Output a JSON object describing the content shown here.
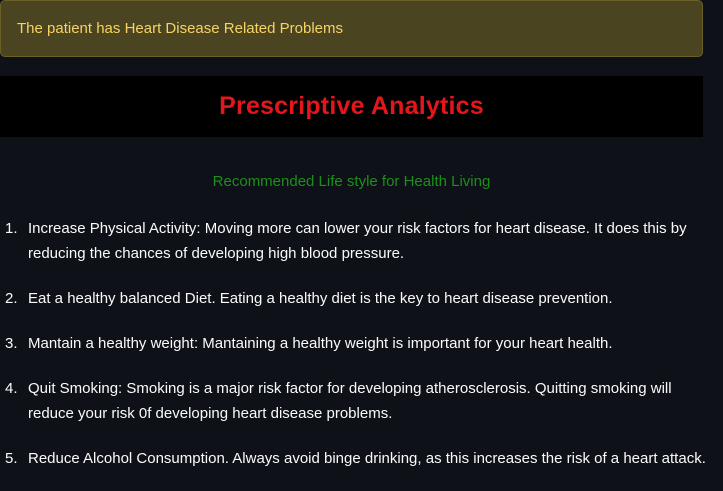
{
  "alert": {
    "text": "The patient has Heart Disease Related Problems"
  },
  "banner": {
    "title": "Prescriptive Analytics"
  },
  "subtitle": "Recommended Life style for Health Living",
  "recommendations": [
    {
      "num": "1.",
      "text": "Increase Physical Activity: Moving more can lower your risk factors for heart disease. It does this by reducing the chances of developing high blood pressure."
    },
    {
      "num": "2.",
      "text": "Eat a healthy balanced Diet. Eating a healthy diet is the key to heart disease prevention."
    },
    {
      "num": "3.",
      "text": "Mantain a healthy weight: Mantaining a healthy weight is important for your heart health."
    },
    {
      "num": "4.",
      "text": "Quit Smoking: Smoking is a major risk factor for developing atherosclerosis. Quitting smoking will reduce your risk 0f developing heart disease problems."
    },
    {
      "num": "5.",
      "text": "Reduce Alcohol Consumption. Always avoid binge drinking, as this increases the risk of a heart attack."
    }
  ],
  "colors": {
    "background": "#0e1117",
    "alert_bg": "#4a4421",
    "alert_text": "#f6d365",
    "banner_bg": "#000000",
    "title_red": "#e4161b",
    "subtitle_green": "#1c8f1c",
    "body_text": "#fafafa"
  }
}
